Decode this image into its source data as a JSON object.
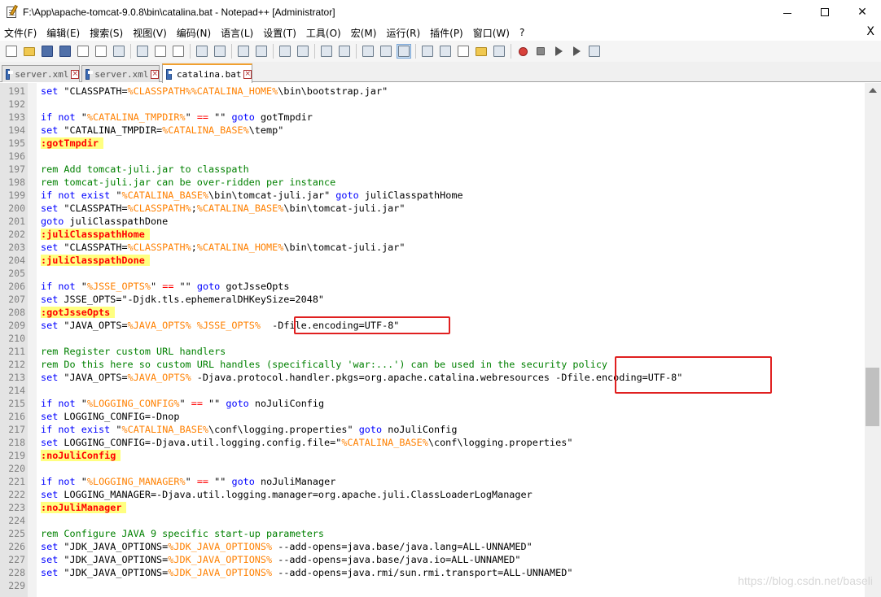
{
  "window": {
    "title": "F:\\App\\apache-tomcat-9.0.8\\bin\\catalina.bat - Notepad++ [Administrator]",
    "minimize_label": "—",
    "maximize_label": "☐",
    "close_label": "✕"
  },
  "menu": {
    "items": [
      "文件(F)",
      "编辑(E)",
      "搜索(S)",
      "视图(V)",
      "编码(N)",
      "语言(L)",
      "设置(T)",
      "工具(O)",
      "宏(M)",
      "运行(R)",
      "插件(P)",
      "窗口(W)",
      "?"
    ],
    "close_doc": "X"
  },
  "toolbar": {
    "icons": [
      "new-file-icon",
      "open-file-icon",
      "save-icon",
      "save-all-icon",
      "close-icon",
      "close-all-icon",
      "print-icon",
      "cut-icon",
      "copy-icon",
      "paste-icon",
      "undo-icon",
      "redo-icon",
      "find-icon",
      "replace-icon",
      "zoom-in-icon",
      "zoom-out-icon",
      "sync-vertical-icon",
      "sync-horizontal-icon",
      "word-wrap-icon",
      "show-all-chars-icon",
      "indent-guide-icon",
      "udl-icon",
      "doc-map-icon",
      "function-list-icon",
      "folder-workspace-icon",
      "monitoring-icon",
      "record-macro-icon",
      "stop-record-icon",
      "play-macro-icon",
      "run-macro-multiple-icon",
      "save-macro-icon"
    ]
  },
  "tabs": [
    {
      "label": "server.xml",
      "active": false
    },
    {
      "label": "server.xml",
      "active": false
    },
    {
      "label": "catalina.bat",
      "active": true
    }
  ],
  "tab_close_glyph": "×",
  "editor": {
    "lines": [
      {
        "n": "191",
        "t": [
          [
            "kw",
            "set"
          ],
          [
            "tx",
            " \"CLASSPATH="
          ],
          [
            "var",
            "%CLASSPATH%"
          ],
          [
            "var",
            "%CATALINA_HOME%"
          ],
          [
            "tx",
            "\\bin\\bootstrap.jar\""
          ]
        ]
      },
      {
        "n": "192",
        "t": []
      },
      {
        "n": "193",
        "t": [
          [
            "kw",
            "if"
          ],
          [
            "tx",
            " "
          ],
          [
            "kw",
            "not"
          ],
          [
            "tx",
            " \""
          ],
          [
            "var",
            "%CATALINA_TMPDIR%"
          ],
          [
            "tx",
            "\" "
          ],
          [
            "op",
            "=="
          ],
          [
            "tx",
            " \"\" "
          ],
          [
            "kw",
            "goto"
          ],
          [
            "tx",
            " gotTmpdir"
          ]
        ]
      },
      {
        "n": "194",
        "t": [
          [
            "kw",
            "set"
          ],
          [
            "tx",
            " \"CATALINA_TMPDIR="
          ],
          [
            "var",
            "%CATALINA_BASE%"
          ],
          [
            "tx",
            "\\temp\""
          ]
        ]
      },
      {
        "n": "195",
        "t": [
          [
            "lbl",
            ":gotTmpdir"
          ]
        ]
      },
      {
        "n": "196",
        "t": []
      },
      {
        "n": "197",
        "t": [
          [
            "cm",
            "rem Add tomcat-juli.jar to classpath"
          ]
        ]
      },
      {
        "n": "198",
        "t": [
          [
            "cm",
            "rem tomcat-juli.jar can be over-ridden per instance"
          ]
        ]
      },
      {
        "n": "199",
        "t": [
          [
            "kw",
            "if"
          ],
          [
            "tx",
            " "
          ],
          [
            "kw",
            "not"
          ],
          [
            "tx",
            " "
          ],
          [
            "kw",
            "exist"
          ],
          [
            "tx",
            " \""
          ],
          [
            "var",
            "%CATALINA_BASE%"
          ],
          [
            "tx",
            "\\bin\\tomcat-juli.jar\" "
          ],
          [
            "kw",
            "goto"
          ],
          [
            "tx",
            " juliClasspathHome"
          ]
        ]
      },
      {
        "n": "200",
        "t": [
          [
            "kw",
            "set"
          ],
          [
            "tx",
            " \"CLASSPATH="
          ],
          [
            "var",
            "%CLASSPATH%"
          ],
          [
            "tx",
            ";"
          ],
          [
            "var",
            "%CATALINA_BASE%"
          ],
          [
            "tx",
            "\\bin\\tomcat-juli.jar\""
          ]
        ]
      },
      {
        "n": "201",
        "t": [
          [
            "kw",
            "goto"
          ],
          [
            "tx",
            " juliClasspathDone"
          ]
        ]
      },
      {
        "n": "202",
        "t": [
          [
            "lbl",
            ":juliClasspathHome"
          ]
        ]
      },
      {
        "n": "203",
        "t": [
          [
            "kw",
            "set"
          ],
          [
            "tx",
            " \"CLASSPATH="
          ],
          [
            "var",
            "%CLASSPATH%"
          ],
          [
            "tx",
            ";"
          ],
          [
            "var",
            "%CATALINA_HOME%"
          ],
          [
            "tx",
            "\\bin\\tomcat-juli.jar\""
          ]
        ]
      },
      {
        "n": "204",
        "t": [
          [
            "lbl",
            ":juliClasspathDone"
          ]
        ]
      },
      {
        "n": "205",
        "t": []
      },
      {
        "n": "206",
        "t": [
          [
            "kw",
            "if"
          ],
          [
            "tx",
            " "
          ],
          [
            "kw",
            "not"
          ],
          [
            "tx",
            " \""
          ],
          [
            "var",
            "%JSSE_OPTS%"
          ],
          [
            "tx",
            "\" "
          ],
          [
            "op",
            "=="
          ],
          [
            "tx",
            " \"\" "
          ],
          [
            "kw",
            "goto"
          ],
          [
            "tx",
            " gotJsseOpts"
          ]
        ]
      },
      {
        "n": "207",
        "t": [
          [
            "kw",
            "set"
          ],
          [
            "tx",
            " JSSE_OPTS=\"-Djdk.tls.ephemeralDHKeySize=2048\""
          ]
        ]
      },
      {
        "n": "208",
        "t": [
          [
            "lbl",
            ":gotJsseOpts"
          ]
        ]
      },
      {
        "n": "209",
        "t": [
          [
            "kw",
            "set"
          ],
          [
            "tx",
            " \"JAVA_OPTS="
          ],
          [
            "var",
            "%JAVA_OPTS%"
          ],
          [
            "tx",
            " "
          ],
          [
            "var",
            "%JSSE_OPTS%"
          ],
          [
            "tx",
            "  -Dfile.encoding=UTF-8\""
          ]
        ]
      },
      {
        "n": "210",
        "t": []
      },
      {
        "n": "211",
        "t": [
          [
            "cm",
            "rem Register custom URL handlers"
          ]
        ]
      },
      {
        "n": "212",
        "t": [
          [
            "cm",
            "rem Do this here so custom URL handles (specifically 'war:...') can be used in the security policy"
          ]
        ]
      },
      {
        "n": "213",
        "t": [
          [
            "kw",
            "set"
          ],
          [
            "tx",
            " \"JAVA_OPTS="
          ],
          [
            "var",
            "%JAVA_OPTS%"
          ],
          [
            "tx",
            " -Djava.protocol.handler.pkgs=org.apache.catalina.webresources -Dfile.encoding=UTF-8\""
          ]
        ]
      },
      {
        "n": "214",
        "t": []
      },
      {
        "n": "215",
        "t": [
          [
            "kw",
            "if"
          ],
          [
            "tx",
            " "
          ],
          [
            "kw",
            "not"
          ],
          [
            "tx",
            " \""
          ],
          [
            "var",
            "%LOGGING_CONFIG%"
          ],
          [
            "tx",
            "\" "
          ],
          [
            "op",
            "=="
          ],
          [
            "tx",
            " \"\" "
          ],
          [
            "kw",
            "goto"
          ],
          [
            "tx",
            " noJuliConfig"
          ]
        ]
      },
      {
        "n": "216",
        "t": [
          [
            "kw",
            "set"
          ],
          [
            "tx",
            " LOGGING_CONFIG=-Dnop"
          ]
        ]
      },
      {
        "n": "217",
        "t": [
          [
            "kw",
            "if"
          ],
          [
            "tx",
            " "
          ],
          [
            "kw",
            "not"
          ],
          [
            "tx",
            " "
          ],
          [
            "kw",
            "exist"
          ],
          [
            "tx",
            " \""
          ],
          [
            "var",
            "%CATALINA_BASE%"
          ],
          [
            "tx",
            "\\conf\\logging.properties\" "
          ],
          [
            "kw",
            "goto"
          ],
          [
            "tx",
            " noJuliConfig"
          ]
        ]
      },
      {
        "n": "218",
        "t": [
          [
            "kw",
            "set"
          ],
          [
            "tx",
            " LOGGING_CONFIG=-Djava.util.logging.config.file=\""
          ],
          [
            "var",
            "%CATALINA_BASE%"
          ],
          [
            "tx",
            "\\conf\\logging.properties\""
          ]
        ]
      },
      {
        "n": "219",
        "t": [
          [
            "lbl",
            ":noJuliConfig"
          ]
        ]
      },
      {
        "n": "220",
        "t": []
      },
      {
        "n": "221",
        "t": [
          [
            "kw",
            "if"
          ],
          [
            "tx",
            " "
          ],
          [
            "kw",
            "not"
          ],
          [
            "tx",
            " \""
          ],
          [
            "var",
            "%LOGGING_MANAGER%"
          ],
          [
            "tx",
            "\" "
          ],
          [
            "op",
            "=="
          ],
          [
            "tx",
            " \"\" "
          ],
          [
            "kw",
            "goto"
          ],
          [
            "tx",
            " noJuliManager"
          ]
        ]
      },
      {
        "n": "222",
        "t": [
          [
            "kw",
            "set"
          ],
          [
            "tx",
            " LOGGING_MANAGER=-Djava.util.logging.manager=org.apache.juli.ClassLoaderLogManager"
          ]
        ]
      },
      {
        "n": "223",
        "t": [
          [
            "lbl",
            ":noJuliManager"
          ]
        ]
      },
      {
        "n": "224",
        "t": []
      },
      {
        "n": "225",
        "t": [
          [
            "cm",
            "rem Configure JAVA 9 specific start-up parameters"
          ]
        ]
      },
      {
        "n": "226",
        "t": [
          [
            "kw",
            "set"
          ],
          [
            "tx",
            " \"JDK_JAVA_OPTIONS="
          ],
          [
            "var",
            "%JDK_JAVA_OPTIONS%"
          ],
          [
            "tx",
            " --add-opens=java.base/java.lang=ALL-UNNAMED\""
          ]
        ]
      },
      {
        "n": "227",
        "t": [
          [
            "kw",
            "set"
          ],
          [
            "tx",
            " \"JDK_JAVA_OPTIONS="
          ],
          [
            "var",
            "%JDK_JAVA_OPTIONS%"
          ],
          [
            "tx",
            " --add-opens=java.base/java.io=ALL-UNNAMED\""
          ]
        ]
      },
      {
        "n": "228",
        "t": [
          [
            "kw",
            "set"
          ],
          [
            "tx",
            " \"JDK_JAVA_OPTIONS="
          ],
          [
            "var",
            "%JDK_JAVA_OPTIONS%"
          ],
          [
            "tx",
            " --add-opens=java.rmi/sun.rmi.transport=ALL-UNNAMED\""
          ]
        ]
      },
      {
        "n": "229",
        "t": []
      }
    ]
  },
  "colors": {
    "keyword": "#0000ff",
    "variable": "#ff8000",
    "operator": "#ff0000",
    "comment": "#008000",
    "label_bg": "#ffff80",
    "annotation_box": "#e02020"
  },
  "watermark": "https://blog.csdn.net/baseli"
}
